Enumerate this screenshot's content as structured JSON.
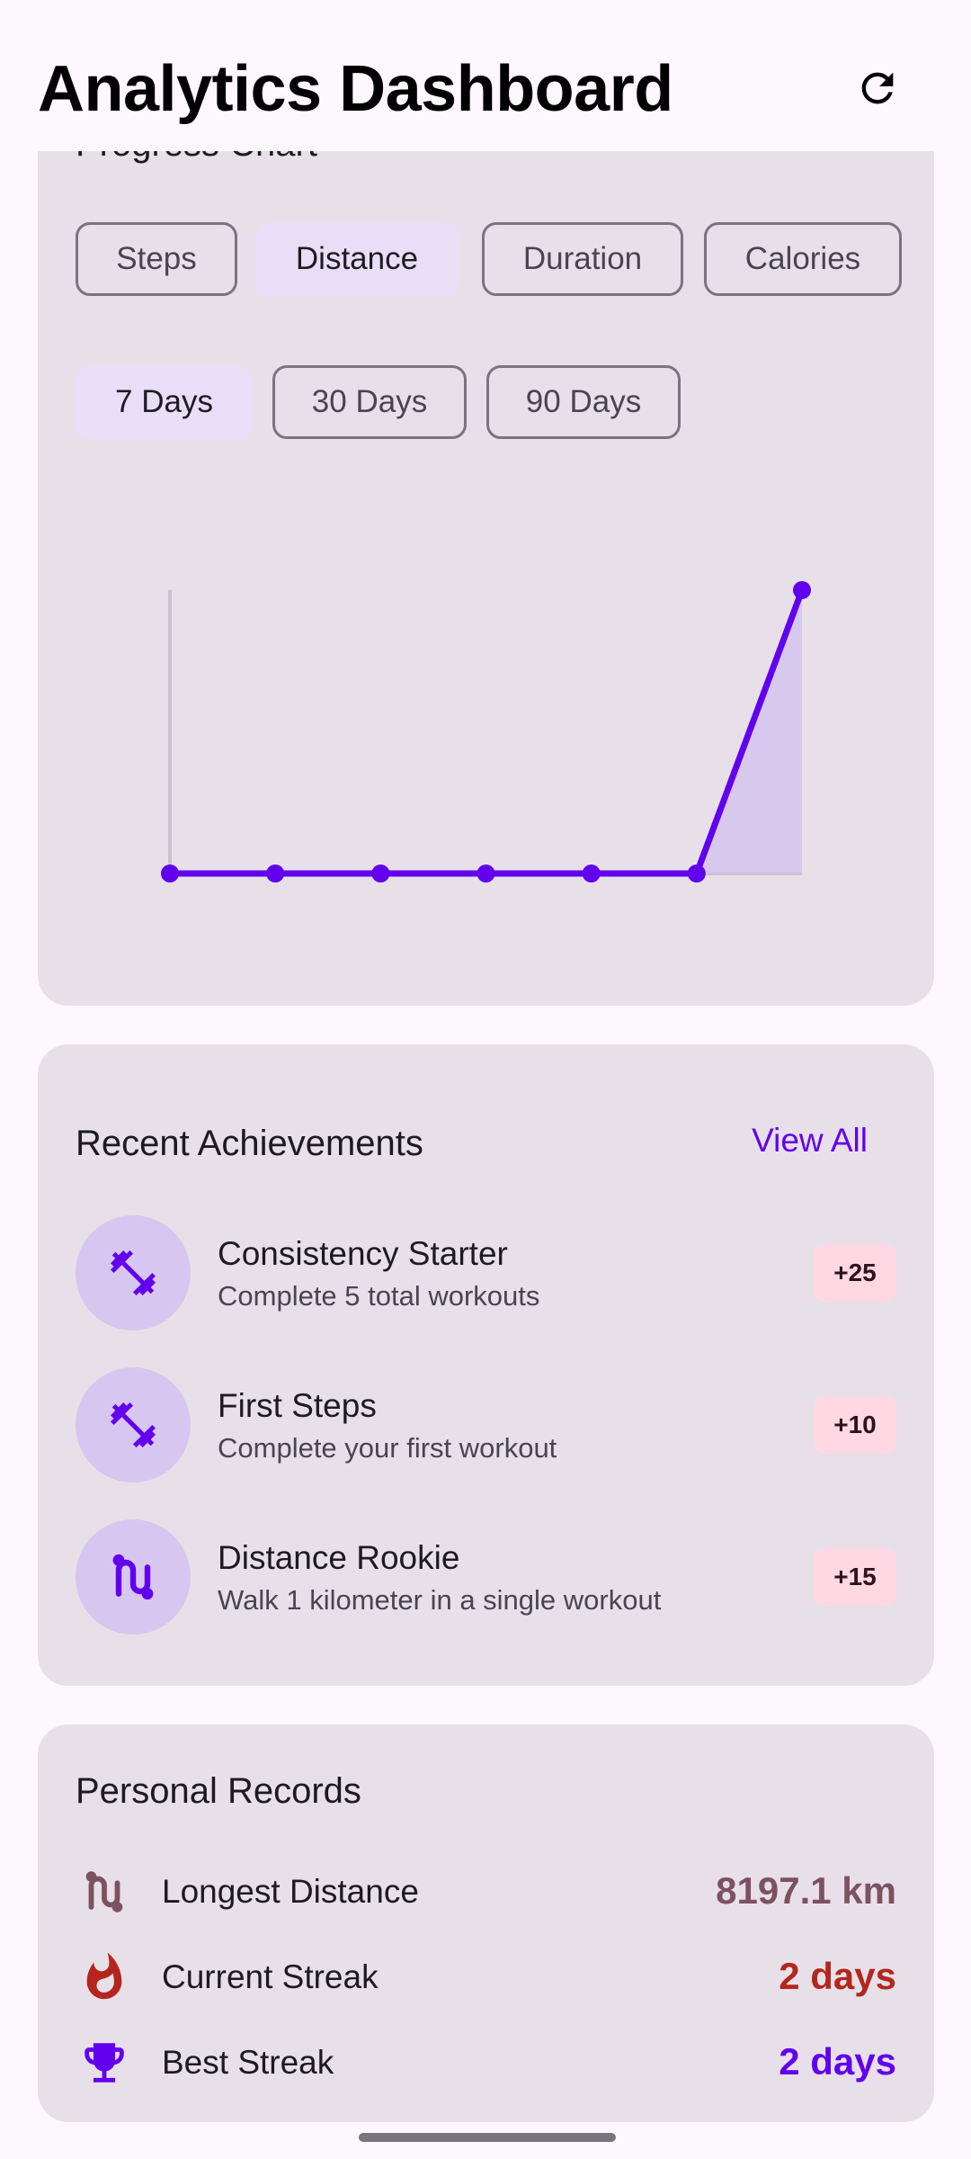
{
  "app_bar": {
    "title": "Analytics Dashboard",
    "refresh_icon": "refresh-icon"
  },
  "progress_card": {
    "title": "Progress Chart",
    "metric_tabs": [
      {
        "label": "Steps",
        "selected": false
      },
      {
        "label": "Distance",
        "selected": true
      },
      {
        "label": "Duration",
        "selected": false
      },
      {
        "label": "Calories",
        "selected": false
      }
    ],
    "range_tabs": [
      {
        "label": "7 Days",
        "selected": true
      },
      {
        "label": "30 Days",
        "selected": false
      },
      {
        "label": "90 Days",
        "selected": false
      }
    ]
  },
  "chart_data": {
    "type": "line",
    "title": "",
    "xlabel": "",
    "ylabel": "",
    "x": [
      1,
      2,
      3,
      4,
      5,
      6,
      7
    ],
    "series": [
      {
        "values": [
          0,
          0,
          0,
          0,
          0,
          0,
          8197.1
        ]
      }
    ],
    "ylim": [
      0,
      8197.1
    ],
    "grid": false,
    "line_color": "#6200ee",
    "fill_color": "#d4c3ee"
  },
  "achievements": {
    "title": "Recent Achievements",
    "view_all": "View All",
    "items": [
      {
        "name": "Consistency Starter",
        "description": "Complete 5 total workouts",
        "points": "+25",
        "icon": "dumbbell-icon"
      },
      {
        "name": "First Steps",
        "description": "Complete your first workout",
        "points": "+10",
        "icon": "dumbbell-icon"
      },
      {
        "name": "Distance Rookie",
        "description": "Walk 1 kilometer in a single workout",
        "points": "+15",
        "icon": "route-icon"
      }
    ]
  },
  "records": {
    "title": "Personal Records",
    "items": [
      {
        "label": "Longest Distance",
        "value": "8197.1 km",
        "icon": "route-icon",
        "color": "#7d5260"
      },
      {
        "label": "Current Streak",
        "value": "2 days",
        "icon": "fire-icon",
        "color": "#b3261e"
      },
      {
        "label": "Best Streak",
        "value": "2 days",
        "icon": "trophy-icon",
        "color": "#6200ee"
      }
    ]
  }
}
